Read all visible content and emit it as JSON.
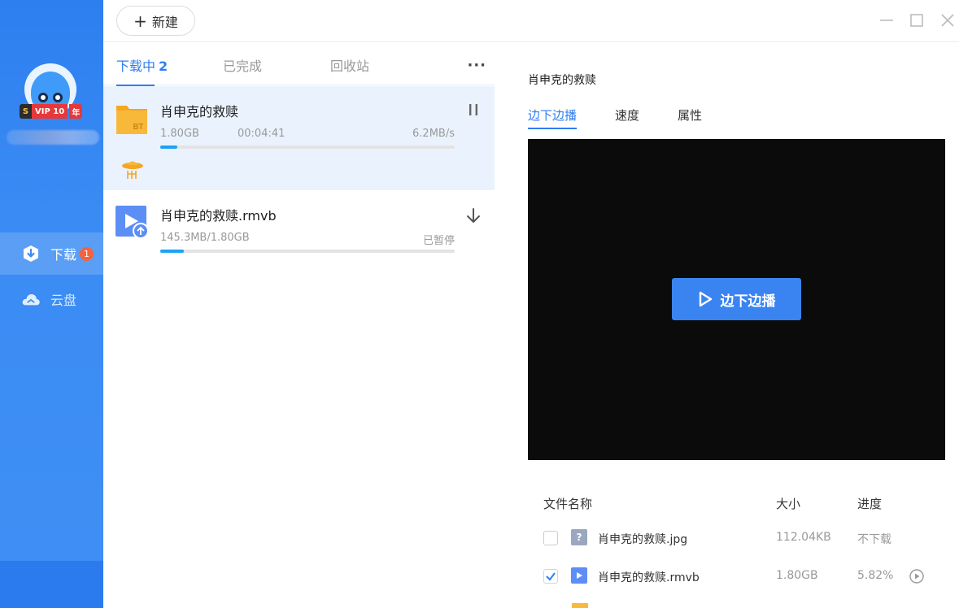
{
  "sidebar": {
    "vip": {
      "s": "S",
      "label": "VIP 10",
      "years": "年"
    },
    "nav": [
      {
        "label": "下载",
        "badge": "1",
        "icon": "download-shield-icon",
        "active": true
      },
      {
        "label": "云盘",
        "icon": "cloud-icon",
        "active": false
      }
    ]
  },
  "toolbar": {
    "new_label": "新建"
  },
  "list": {
    "tabs": [
      {
        "label": "下载中",
        "count": "2"
      },
      {
        "label": "已完成"
      },
      {
        "label": "回收站"
      }
    ],
    "more": "···",
    "tasks": [
      {
        "name": "肖申克的救赎",
        "size": "1.80GB",
        "time": "00:04:41",
        "speed": "6.2MB/s",
        "progress": 0.058,
        "icon": "bt-folder-icon",
        "folder_label": "BT",
        "action": "pause"
      },
      {
        "name": "肖申克的救赎.rmvb",
        "size": "145.3MB/1.80GB",
        "status": "已暂停",
        "progress": 0.079,
        "icon": "video-file-icon",
        "action": "download"
      }
    ]
  },
  "detail": {
    "title": "肖申克的救赎",
    "tabs": [
      "边下边播",
      "速度",
      "属性"
    ],
    "play_label": "边下边播",
    "columns": {
      "name": "文件名称",
      "size": "大小",
      "progress": "进度"
    },
    "files": [
      {
        "name": "肖申克的救赎.jpg",
        "size": "112.04KB",
        "progress": "不下载",
        "checked": false,
        "icon": "unknown-file-icon",
        "icon_char": "?"
      },
      {
        "name": "肖申克的救赎.rmvb",
        "size": "1.80GB",
        "progress": "5.82%",
        "checked": true,
        "icon": "video-file-icon"
      }
    ]
  },
  "colors": {
    "accent": "#2f7ef0",
    "sidebar": "#3a8bf3",
    "progress": "#1aa3f5",
    "badge": "#f5623c",
    "vip_red": "#e6383a"
  }
}
